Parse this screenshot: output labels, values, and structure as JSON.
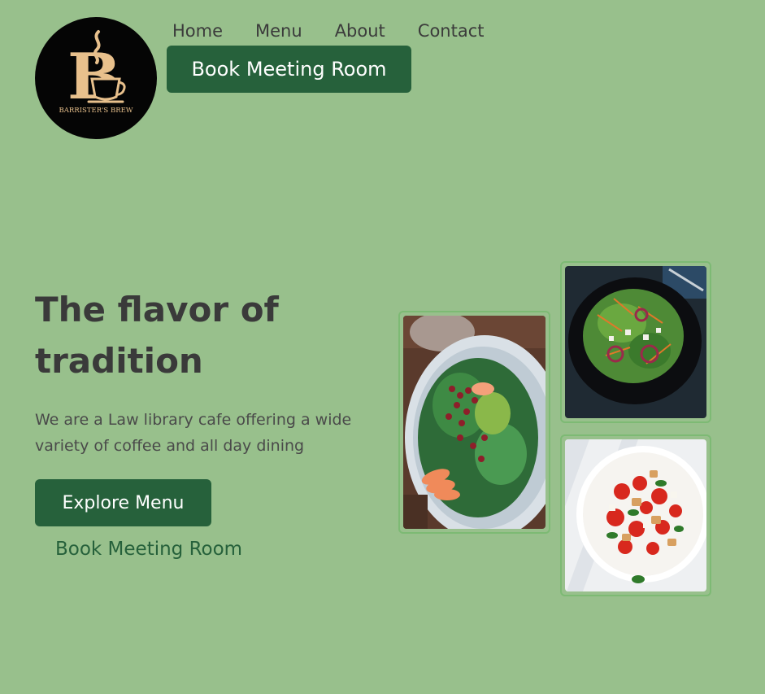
{
  "logo": {
    "letter": "B",
    "brand_text": "BARRISTER'S BREW",
    "colors": {
      "background": "#050505",
      "gold": "#e8c08c"
    }
  },
  "nav": {
    "items": [
      {
        "label": "Home"
      },
      {
        "label": "Menu"
      },
      {
        "label": "About"
      },
      {
        "label": "Contact"
      }
    ],
    "book_button_label": "Book Meeting Room"
  },
  "hero": {
    "title_line1": "The flavor of",
    "title_line2": "tradition",
    "description": "We are a Law library cafe offering a wide variety of coffee and all day dining",
    "explore_button_label": "Explore Menu",
    "book_link_label": "Book Meeting Room"
  },
  "gallery": {
    "images": [
      {
        "subject": "spinach-pomegranate-salad"
      },
      {
        "subject": "dark-bowl-green-salad"
      },
      {
        "subject": "tomato-bread-salad"
      }
    ]
  },
  "colors": {
    "page_background": "#98c08c",
    "accent_green": "#26613b",
    "photo_border": "#7dba74",
    "text": "#3a3a3a"
  }
}
